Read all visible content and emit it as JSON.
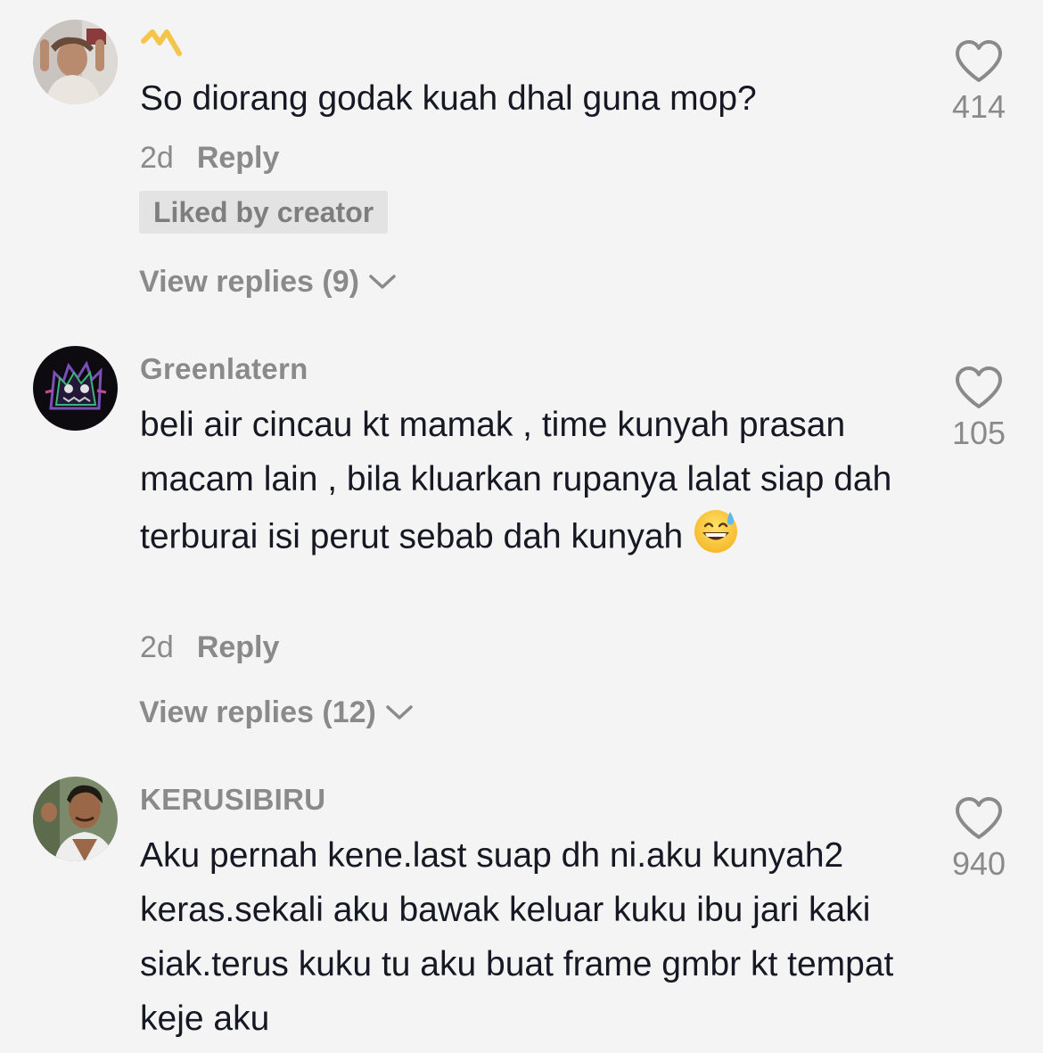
{
  "comments": [
    {
      "username": "",
      "username_mark": "crown-logo",
      "text": "So diorang godak kuah dhal guna mop?",
      "time": "2d",
      "reply_label": "Reply",
      "liked_by_creator": "Liked by creator",
      "view_replies": "View replies (9)",
      "likes": "414"
    },
    {
      "username": "Greenlatern",
      "text": "beli air cincau kt mamak , time kunyah prasan macam lain , bila kluarkan rupanya lalat siap dah terburai isi perut sebab dah kunyah",
      "emoji": "😅",
      "time": "2d",
      "reply_label": "Reply",
      "view_replies": "View replies (12)",
      "likes": "105"
    },
    {
      "username": "KERUSIBIRU",
      "text": "Aku pernah kene.last suap dh ni.aku kunyah2 keras.sekali aku bawak keluar kuku ibu jari kaki siak.terus kuku tu aku buat frame gmbr kt tempat keje aku",
      "likes": "940"
    }
  ],
  "icons": {
    "like": "heart-outline-icon",
    "expand": "chevron-down-icon"
  },
  "colors": {
    "background": "#f4f4f4",
    "text": "#161823",
    "muted": "#8a8a8a",
    "badge": "#e3e3e3",
    "crown": "#f5c54a"
  }
}
